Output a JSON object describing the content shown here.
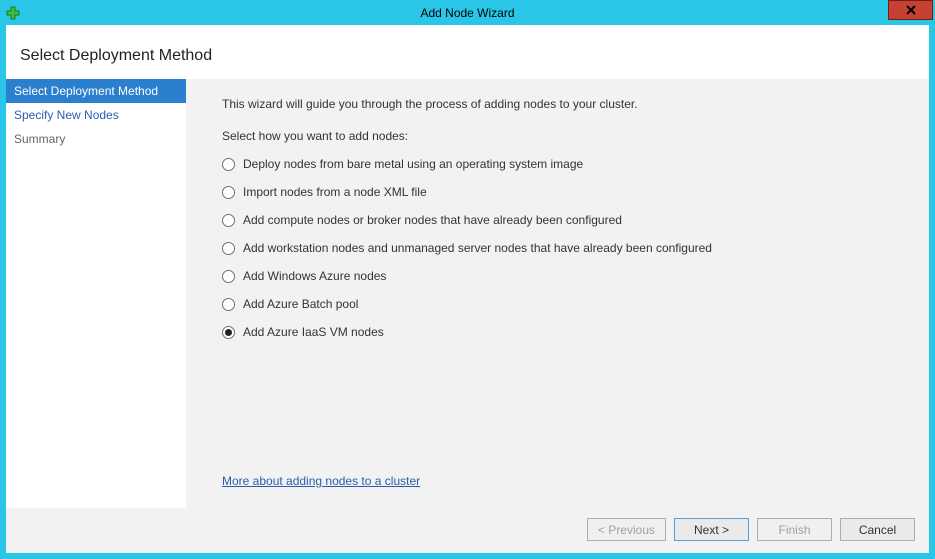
{
  "window": {
    "title": "Add Node Wizard",
    "close_label": "✕"
  },
  "header": {
    "title": "Select Deployment Method"
  },
  "sidebar": {
    "items": [
      {
        "label": "Select Deployment Method",
        "state": "active"
      },
      {
        "label": "Specify New Nodes",
        "state": "link"
      },
      {
        "label": "Summary",
        "state": "normal"
      }
    ]
  },
  "content": {
    "intro": "This wizard will guide you through the process of adding nodes to your cluster.",
    "select_how": "Select how you want to add nodes:",
    "options": [
      {
        "label": "Deploy nodes from bare metal using an operating system image",
        "checked": false
      },
      {
        "label": "Import nodes from a node XML file",
        "checked": false
      },
      {
        "label": "Add compute nodes or broker nodes that have already been configured",
        "checked": false
      },
      {
        "label": "Add workstation nodes and unmanaged server nodes that have already been configured",
        "checked": false
      },
      {
        "label": "Add Windows Azure nodes",
        "checked": false
      },
      {
        "label": "Add Azure Batch pool",
        "checked": false
      },
      {
        "label": "Add Azure IaaS VM nodes",
        "checked": true
      }
    ],
    "help_link": "More about adding nodes to a cluster"
  },
  "footer": {
    "previous": "< Previous",
    "next": "Next >",
    "finish": "Finish",
    "cancel": "Cancel"
  }
}
